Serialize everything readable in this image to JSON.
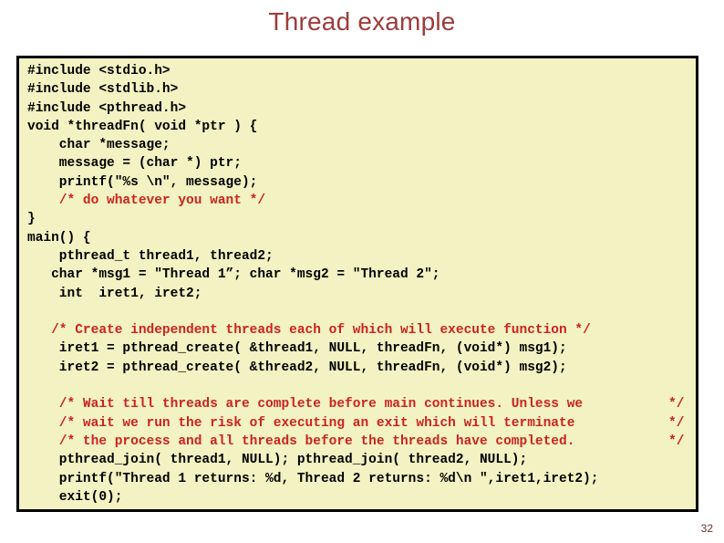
{
  "slide": {
    "title": "Thread example",
    "number": "32",
    "title_color": "#9E3B3B",
    "code_background": "#F2F2C2",
    "code_border_color": "#000000",
    "code_text_color": "#000000",
    "comment_color": "#CC2222",
    "page_background": "#FFFFFF"
  },
  "code": {
    "lines": [
      {
        "text": "#include <stdio.h>",
        "kind": "code"
      },
      {
        "text": "#include <stdlib.h>",
        "kind": "code"
      },
      {
        "text": "#include <pthread.h>",
        "kind": "code"
      },
      {
        "text": "void *threadFn( void *ptr ) {",
        "kind": "code"
      },
      {
        "text": "    char *message;",
        "kind": "code"
      },
      {
        "text": "    message = (char *) ptr;",
        "kind": "code"
      },
      {
        "text": "    printf(\"%s \\n\", message);",
        "kind": "code"
      },
      {
        "text": "    /* do whatever you want */",
        "kind": "comment"
      },
      {
        "text": "}",
        "kind": "code"
      },
      {
        "text": "main() {",
        "kind": "code"
      },
      {
        "text": "    pthread_t thread1, thread2;",
        "kind": "code"
      },
      {
        "text": "   char *msg1 = \"Thread 1”; char *msg2 = \"Thread 2\";",
        "kind": "code"
      },
      {
        "text": "    int  iret1, iret2;",
        "kind": "code"
      },
      {
        "text": "",
        "kind": "blank"
      },
      {
        "text": "   /* Create independent threads each of which will execute function */",
        "kind": "comment"
      },
      {
        "text": "    iret1 = pthread_create( &thread1, NULL, threadFn, (void*) msg1);",
        "kind": "code"
      },
      {
        "text": "    iret2 = pthread_create( &thread2, NULL, threadFn, (void*) msg2);",
        "kind": "code"
      },
      {
        "text": "",
        "kind": "blank"
      },
      {
        "text": "    /* Wait till threads are complete before main continues. Unless we",
        "tail": "*/",
        "kind": "comment"
      },
      {
        "text": "    /* wait we run the risk of executing an exit which will terminate",
        "tail": "*/",
        "kind": "comment"
      },
      {
        "text": "    /* the process and all threads before the threads have completed.",
        "tail": "*/",
        "kind": "comment"
      },
      {
        "text": "    pthread_join( thread1, NULL); pthread_join( thread2, NULL);",
        "kind": "code"
      },
      {
        "text": "    printf(\"Thread 1 returns: %d, Thread 2 returns: %d\\n \",iret1,iret2);",
        "kind": "code"
      },
      {
        "text": "    exit(0);",
        "kind": "code"
      },
      {
        "text": "",
        "kind": "blank"
      },
      {
        "text": "}",
        "kind": "code"
      }
    ]
  }
}
